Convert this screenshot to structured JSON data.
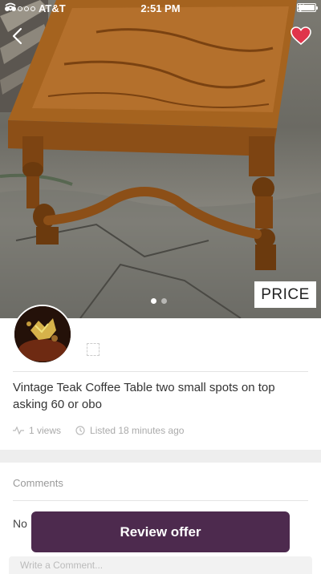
{
  "status_bar": {
    "carrier": "AT&T",
    "time": "2:51 PM"
  },
  "listing": {
    "price_label": "PRICE",
    "title": "Vintage Teak Coffee Table two small spots on top asking 60 or obo",
    "views": "1 views",
    "listed": "Listed 18 minutes ago",
    "image_count": 2,
    "active_image": 1
  },
  "comments": {
    "header": "Comments",
    "empty_text": "No",
    "input_placeholder": "Write a Comment..."
  },
  "actions": {
    "review_offer": "Review offer"
  },
  "colors": {
    "accent": "#4d2a4e",
    "heart": "#e0344b"
  }
}
